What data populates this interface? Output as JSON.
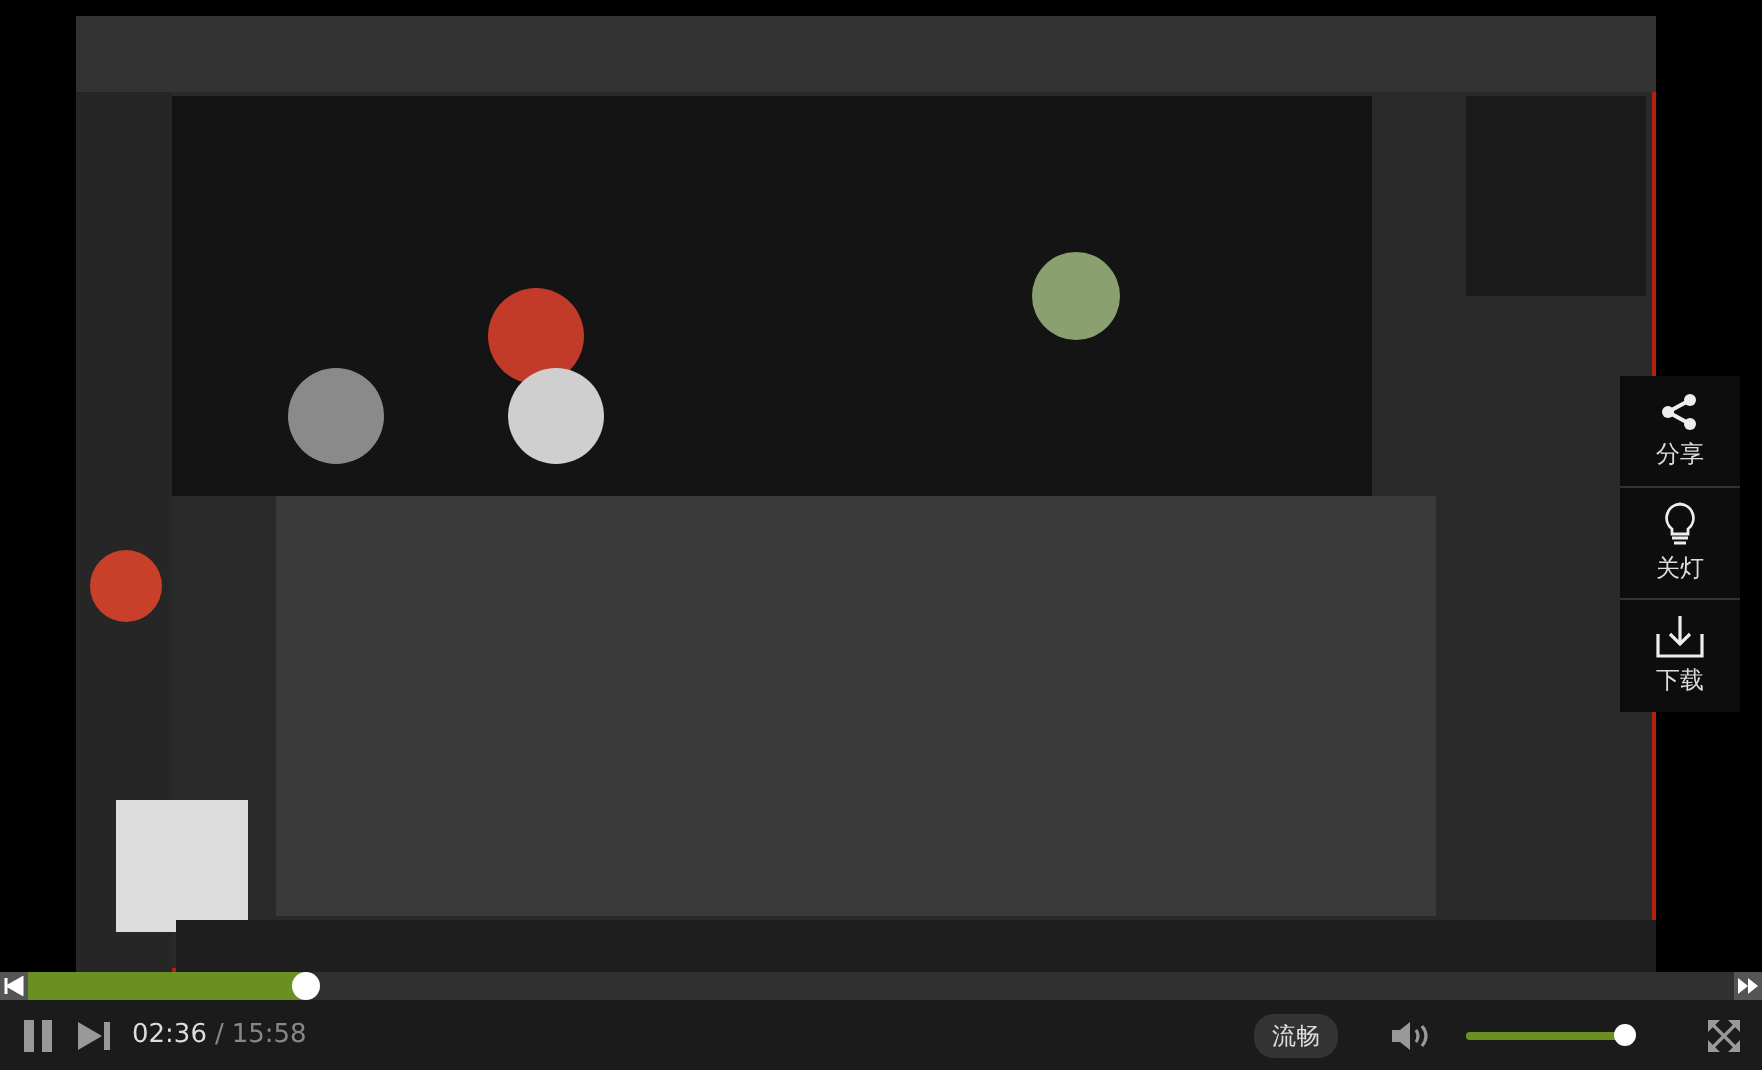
{
  "side_actions": [
    {
      "kind": "share",
      "label": "分享"
    },
    {
      "kind": "light",
      "label": "关灯"
    },
    {
      "kind": "download",
      "label": "下载"
    }
  ],
  "progress": {
    "level": 0.163
  },
  "controls": {
    "playing": true,
    "current_time": "02:36",
    "separator": "/",
    "duration": "15:58",
    "quality": "流畅",
    "volume": {
      "level": 1.0
    }
  }
}
